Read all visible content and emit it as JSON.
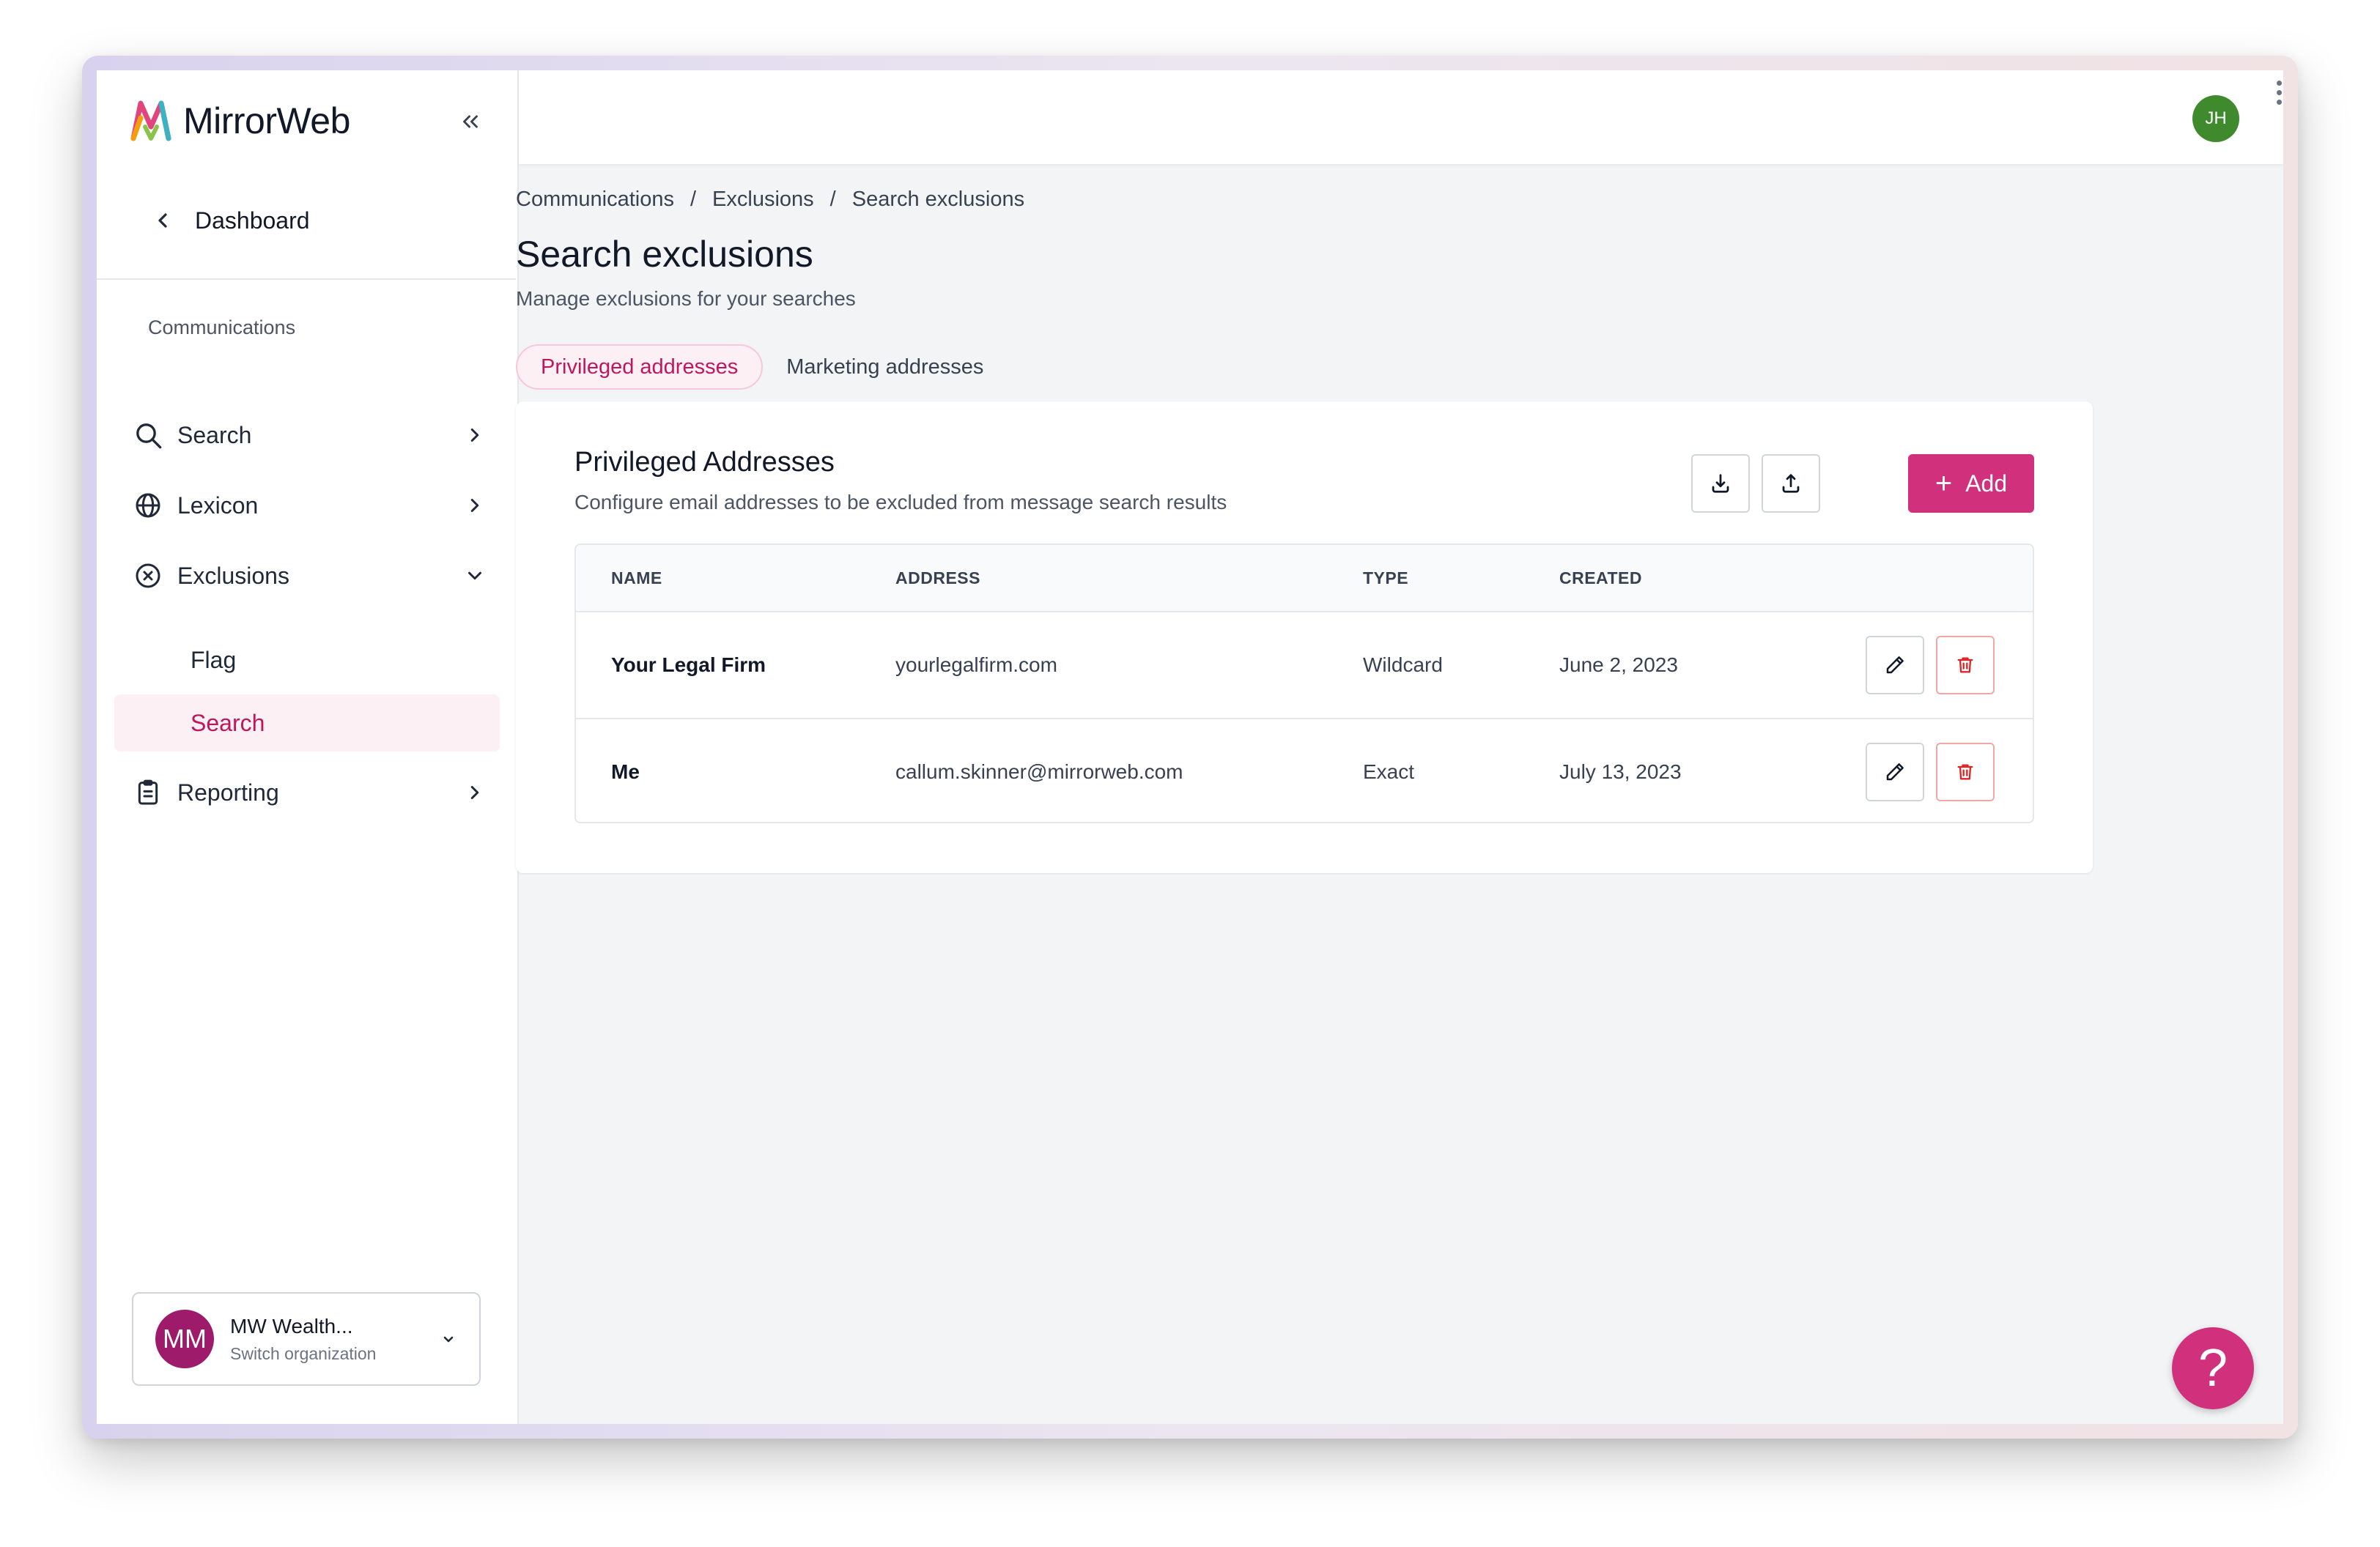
{
  "brand": {
    "name": "MirrorWeb"
  },
  "sidebar": {
    "back_label": "Dashboard",
    "section_label": "Communications",
    "items": [
      {
        "label": "Search",
        "icon": "search-icon"
      },
      {
        "label": "Lexicon",
        "icon": "globe-icon"
      },
      {
        "label": "Exclusions",
        "icon": "x-circle-icon"
      },
      {
        "label": "Reporting",
        "icon": "clipboard-icon"
      }
    ],
    "sub_items": [
      {
        "label": "Flag"
      },
      {
        "label": "Search",
        "active": true
      }
    ],
    "org": {
      "initials": "MM",
      "name": "MW Wealth...",
      "action": "Switch organization"
    }
  },
  "topbar": {
    "user_initials": "JH"
  },
  "breadcrumb": [
    "Communications",
    "Exclusions",
    "Search exclusions"
  ],
  "page": {
    "title": "Search exclusions",
    "subtitle": "Manage exclusions for your searches"
  },
  "tabs": [
    {
      "label": "Privileged addresses",
      "active": true
    },
    {
      "label": "Marketing addresses",
      "active": false
    }
  ],
  "card": {
    "title": "Privileged Addresses",
    "subtitle": "Configure email addresses to be excluded from message search results",
    "add_label": "Add"
  },
  "table": {
    "columns": [
      "NAME",
      "ADDRESS",
      "TYPE",
      "CREATED"
    ],
    "rows": [
      {
        "name": "Your Legal Firm",
        "address": "yourlegalfirm.com",
        "type": "Wildcard",
        "created": "June 2, 2023"
      },
      {
        "name": "Me",
        "address": "callum.skinner@mirrorweb.com",
        "type": "Exact",
        "created": "July 13, 2023"
      }
    ]
  },
  "help": {
    "symbol": "?"
  },
  "colors": {
    "accent": "#d1307d",
    "accent_text": "#be185d",
    "delete": "#dc2626",
    "user_avatar": "#3f8a2c",
    "org_avatar": "#9d1b6a"
  }
}
